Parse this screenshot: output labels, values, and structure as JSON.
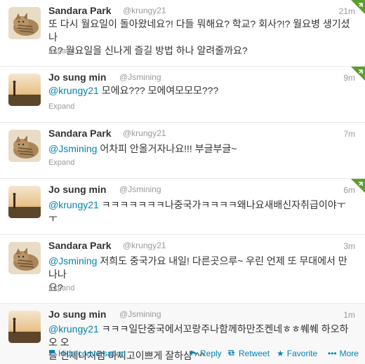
{
  "tweets": [
    {
      "fullname": "Sandara Park",
      "username": "@krungy21",
      "time": "21m",
      "mention": "",
      "text_line1": "또 다시 월요일이 돌아왔네요?! 다들 뭐해요? 학교? 회사?!? 월요병 생기셨나",
      "text_line2": "요? 월요일을 신나게 즐길 방법 하나 알려줄까요?",
      "expand": "Expand",
      "retweet_badge": true
    },
    {
      "fullname": "Jo sung min",
      "username": "@Jsmining",
      "time": "9m",
      "mention": "@krungy21",
      "text_line1": " 모에요??? 모에여모모모???",
      "text_line2": "",
      "expand": "Expand",
      "retweet_badge": true
    },
    {
      "fullname": "Sandara Park",
      "username": "@krungy21",
      "time": "7m",
      "mention": "@Jsmining",
      "text_line1": " 어차피 안올거자나요!!! 부글부글~",
      "text_line2": "",
      "expand": "Expand",
      "retweet_badge": false
    },
    {
      "fullname": "Jo sung min",
      "username": "@Jsmining",
      "time": "6m",
      "mention": "@krungy21",
      "text_line1": " ㅋㅋㅋㅋㅋㅋㅋ나중국가ㅋㅋㅋㅋ왜나요새배신자취급이야ㅜㅜ",
      "text_line2": "",
      "expand": "",
      "retweet_badge": true
    },
    {
      "fullname": "Sandara Park",
      "username": "@krungy21",
      "time": "3m",
      "mention": "@Jsmining",
      "text_line1": " 저희도 중국가요 내일! 다른곳으루~ 우린 언제 또 무대에서 만나나",
      "text_line2": "요?",
      "expand": "Expand",
      "retweet_badge": false
    },
    {
      "fullname": "Jo sung min",
      "username": "@Jsmining",
      "time": "1m",
      "mention": "@krungy21",
      "text_line1": " ㅋㅋㅋ일단중국에서꼬랑주나함께하만조켄네ㅎㅎ쒜쒜 하오하오 오",
      "text_line2": "늘 언제나처럼 마찌고이쁘게 잘하삼 ^^",
      "expand": "",
      "retweet_badge": false
    }
  ],
  "actions": {
    "hide": "Hide conversation",
    "reply": "Reply",
    "retweet": "Retweet",
    "favorite": "Favorite",
    "more": "More"
  },
  "icons": {
    "hide": "chat-bubble-icon",
    "reply": "reply-arrow-icon",
    "retweet": "retweet-icon",
    "favorite": "star-icon",
    "more": "dots-icon",
    "corner": "retweeted-corner-icon"
  },
  "colors": {
    "link": "#0084b4",
    "meta": "#999999",
    "badge": "#5c9e2e"
  }
}
